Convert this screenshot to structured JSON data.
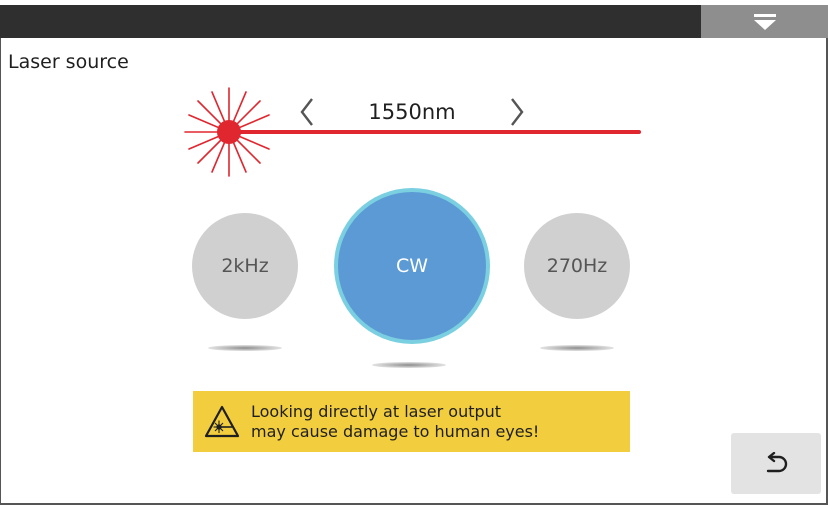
{
  "header": {
    "dropdown_icon": "caret-down-icon"
  },
  "page": {
    "title": "Laser source"
  },
  "wavelength": {
    "value": "1550nm",
    "prev_icon": "chevron-left-icon",
    "next_icon": "chevron-right-icon"
  },
  "modes": [
    {
      "label": "2kHz",
      "selected": false
    },
    {
      "label": "CW",
      "selected": true
    },
    {
      "label": "270Hz",
      "selected": false
    }
  ],
  "warning": {
    "line1": "Looking directly at laser output",
    "line2": "may cause damage to human eyes!",
    "icon": "laser-warning-icon",
    "background": "#f2cd3d"
  },
  "footer": {
    "back_icon": "back-arrow-icon"
  },
  "colors": {
    "laser": "#e0262e",
    "selected_mode": "#5c9ad5",
    "selected_ring": "#7ad0e0",
    "unselected_mode": "#d0d0d0",
    "top_bar": "#2f2f2f"
  }
}
